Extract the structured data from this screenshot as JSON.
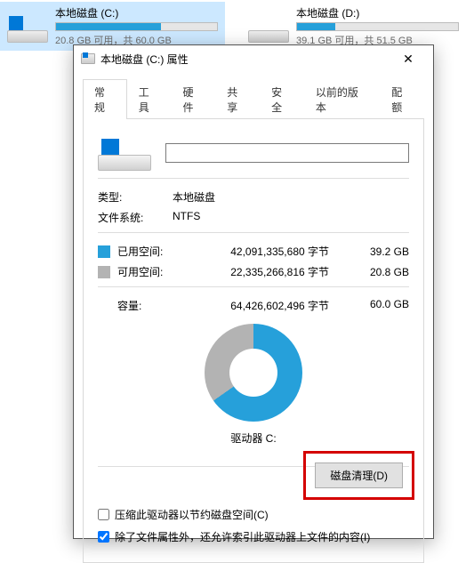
{
  "bg": {
    "drives": [
      {
        "name": "本地磁盘 (C:)",
        "free": "20.8 GB 可用，共 60.0 GB",
        "fillPct": 65,
        "hasWin": true,
        "selected": true
      },
      {
        "name": "本地磁盘 (D:)",
        "free": "39.1 GB 可用，共 51.5 GB",
        "fillPct": 24,
        "hasWin": false,
        "selected": false
      }
    ]
  },
  "dialog": {
    "title": "本地磁盘 (C:) 属性",
    "tabs": [
      "常规",
      "工具",
      "硬件",
      "共享",
      "安全",
      "以前的版本",
      "配额"
    ],
    "activeTab": 0,
    "nameInput": "",
    "typeLabel": "类型:",
    "typeValue": "本地磁盘",
    "fsLabel": "文件系统:",
    "fsValue": "NTFS",
    "usedLabel": "已用空间:",
    "usedBytes": "42,091,335,680 字节",
    "usedGb": "39.2 GB",
    "freeLabel": "可用空间:",
    "freeBytes": "22,335,266,816 字节",
    "freeGb": "20.8 GB",
    "capacityLabel": "容量:",
    "capacityBytes": "64,426,602,496 字节",
    "capacityGb": "60.0 GB",
    "driveLabel": "驱动器 C:",
    "cleanupBtn": "磁盘清理(D)",
    "compressLabel": "压缩此驱动器以节约磁盘空间(C)",
    "indexLabel": "除了文件属性外，还允许索引此驱动器上文件的内容(I)"
  },
  "chart_data": {
    "type": "pie",
    "title": "驱动器 C:",
    "series": [
      {
        "name": "已用空间",
        "value": 39.2,
        "color": "#26a0da"
      },
      {
        "name": "可用空间",
        "value": 20.8,
        "color": "#b3b3b3"
      }
    ],
    "unit": "GB",
    "total": 60.0
  }
}
